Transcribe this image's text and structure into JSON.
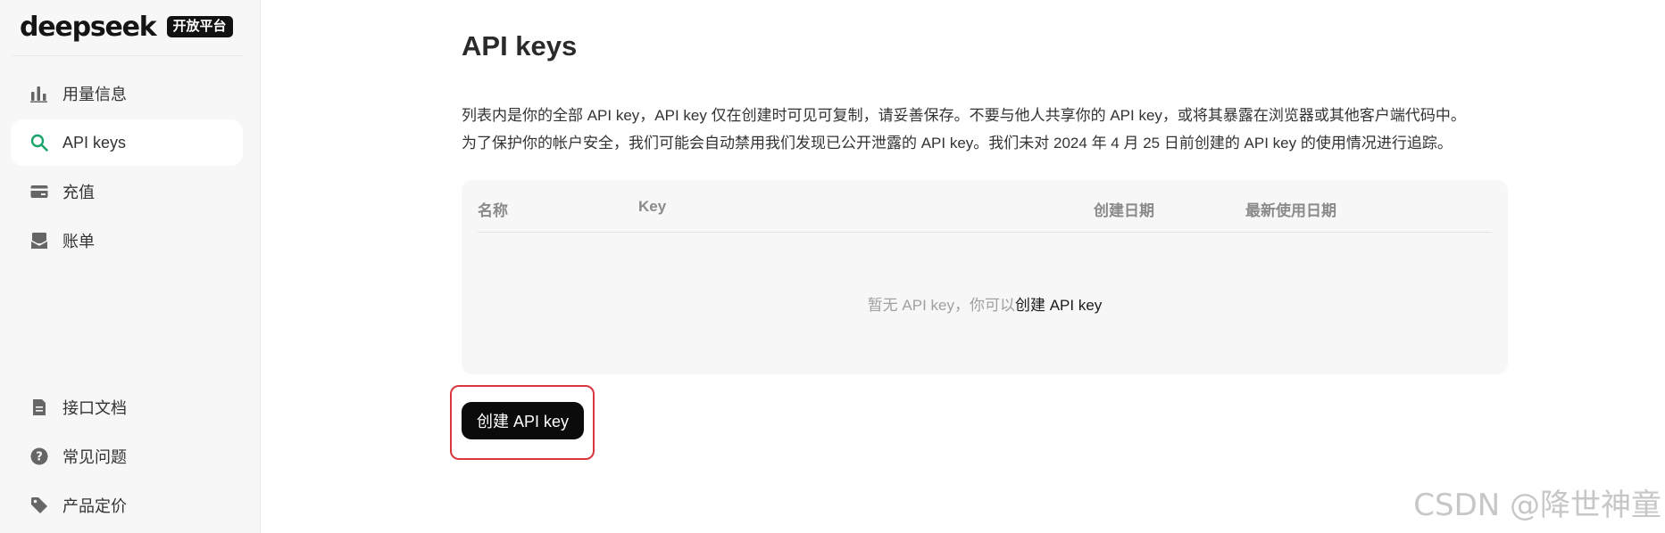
{
  "brand": {
    "name": "deepseek",
    "badge": "开放平台"
  },
  "sidebar": {
    "items": [
      {
        "label": "用量信息",
        "icon": "bar-chart-icon",
        "active": false
      },
      {
        "label": "API keys",
        "icon": "search-key-icon",
        "active": true
      },
      {
        "label": "充值",
        "icon": "credit-card-icon",
        "active": false
      },
      {
        "label": "账单",
        "icon": "bill-icon",
        "active": false
      }
    ],
    "bottom_items": [
      {
        "label": "接口文档",
        "icon": "document-icon"
      },
      {
        "label": "常见问题",
        "icon": "question-icon"
      },
      {
        "label": "产品定价",
        "icon": "price-tag-icon"
      }
    ]
  },
  "main": {
    "title": "API keys",
    "description_line1": "列表内是你的全部 API key，API key 仅在创建时可见可复制，请妥善保存。不要与他人共享你的 API key，或将其暴露在浏览器或其他客户端代码中。",
    "description_line2": "为了保护你的帐户安全，我们可能会自动禁用我们发现已公开泄露的 API key。我们未对 2024 年 4 月 25 日前创建的 API key 的使用情况进行追踪。",
    "table": {
      "columns": [
        "名称",
        "Key",
        "创建日期",
        "最新使用日期"
      ],
      "empty_text": "暂无 API key，你可以",
      "empty_link": "创建 API key"
    },
    "create_button_label": "创建 API key"
  },
  "watermark": "CSDN @降世神童",
  "colors": {
    "sidebar_bg": "#f7f7f7",
    "active_icon": "#1aa36b",
    "button_bg": "#0b0b0b",
    "highlight_border": "#d9363e"
  }
}
